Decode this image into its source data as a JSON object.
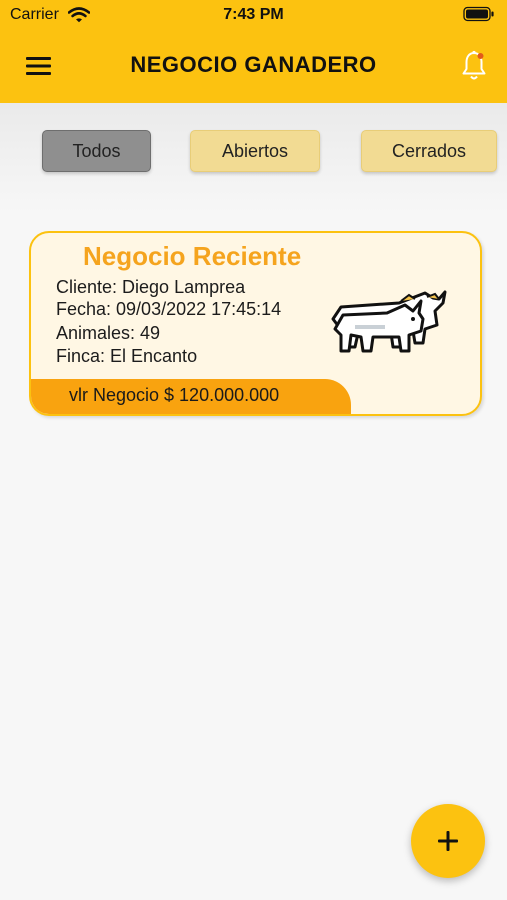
{
  "status_bar": {
    "carrier": "Carrier",
    "time": "7:43 PM"
  },
  "header": {
    "title": "NEGOCIO GANADERO",
    "menu_icon": "hamburger-menu-icon",
    "notification_icon": "bell-icon"
  },
  "filters": [
    {
      "label": "Todos",
      "selected": true
    },
    {
      "label": "Abiertos",
      "selected": false
    },
    {
      "label": "Cerrados",
      "selected": false
    }
  ],
  "deal_card": {
    "title": "Negocio Reciente",
    "cliente": "Cliente: Diego Lamprea",
    "fecha": "Fecha: 09/03/2022 17:45:14",
    "animales": "Animales: 49",
    "finca": "Finca: El Encanto",
    "valor": "vlr Negocio $ 120.000.000",
    "icon": "bull-icon"
  },
  "fab": {
    "icon": "plus-icon"
  },
  "colors": {
    "primary": "#fcc210",
    "accent": "#f9a30f",
    "title_orange": "#f5a41e",
    "card_bg": "#fff7e4",
    "chip_selected": "#8f8f8f",
    "chip": "#f2db93"
  }
}
